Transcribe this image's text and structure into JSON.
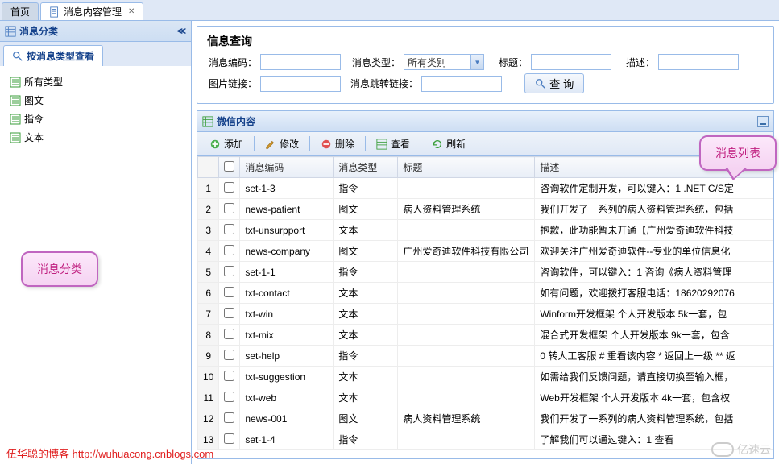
{
  "tabs": {
    "home": "首页",
    "active": "消息内容管理"
  },
  "sidebar": {
    "title": "消息分类",
    "tab_label": "按消息类型查看",
    "tree": [
      "所有类型",
      "图文",
      "指令",
      "文本"
    ]
  },
  "search": {
    "title": "信息查询",
    "code_label": "消息编码：",
    "type_label": "消息类型：",
    "type_value": "所有类别",
    "title_label": "标题：",
    "desc_label": "描述：",
    "img_label": "图片链接：",
    "jump_label": "消息跳转链接：",
    "btn": "查 询"
  },
  "grid": {
    "title": "微信内容",
    "tools": {
      "add": "添加",
      "edit": "修改",
      "delete": "删除",
      "view": "查看",
      "refresh": "刷新"
    },
    "cols": {
      "code": "消息编码",
      "type": "消息类型",
      "title": "标题",
      "desc": "描述"
    },
    "rows": [
      {
        "n": "1",
        "code": "set-1-3",
        "type": "指令",
        "title": "",
        "desc": "咨询软件定制开发，可以键入：1 .NET C/S定"
      },
      {
        "n": "2",
        "code": "news-patient",
        "type": "图文",
        "title": "病人资料管理系统",
        "desc": "我们开发了一系列的病人资料管理系统，包括"
      },
      {
        "n": "3",
        "code": "txt-unsurpport",
        "type": "文本",
        "title": "",
        "desc": "抱歉，此功能暂未开通【广州爱奇迪软件科技"
      },
      {
        "n": "4",
        "code": "news-company",
        "type": "图文",
        "title": "广州爱奇迪软件科技有限公司",
        "desc": "欢迎关注广州爱奇迪软件--专业的单位信息化"
      },
      {
        "n": "5",
        "code": "set-1-1",
        "type": "指令",
        "title": "",
        "desc": "咨询软件，可以键入：1 咨询《病人资料管理"
      },
      {
        "n": "6",
        "code": "txt-contact",
        "type": "文本",
        "title": "",
        "desc": "如有问题，欢迎拨打客服电话：18620292076"
      },
      {
        "n": "7",
        "code": "txt-win",
        "type": "文本",
        "title": "",
        "desc": "Winform开发框架 个人开发版本 5k一套，包"
      },
      {
        "n": "8",
        "code": "txt-mix",
        "type": "文本",
        "title": "",
        "desc": "混合式开发框架 个人开发版本 9k一套，包含"
      },
      {
        "n": "9",
        "code": "set-help",
        "type": "指令",
        "title": "",
        "desc": "0 转人工客服 # 重看该内容 * 返回上一级 ** 返"
      },
      {
        "n": "10",
        "code": "txt-suggestion",
        "type": "文本",
        "title": "",
        "desc": "如需给我们反馈问题，请直接切换至输入框，"
      },
      {
        "n": "11",
        "code": "txt-web",
        "type": "文本",
        "title": "",
        "desc": "Web开发框架 个人开发版本 4k一套，包含权"
      },
      {
        "n": "12",
        "code": "news-001",
        "type": "图文",
        "title": "病人资料管理系统",
        "desc": "我们开发了一系列的病人资料管理系统，包括"
      },
      {
        "n": "13",
        "code": "set-1-4",
        "type": "指令",
        "title": "",
        "desc": "了解我们可以通过键入：1 查看"
      }
    ]
  },
  "callouts": {
    "c1": "消息分类",
    "c2": "消息列表"
  },
  "footer": "伍华聪的博客 http://wuhuacong.cnblogs.com",
  "watermark": "亿速云"
}
